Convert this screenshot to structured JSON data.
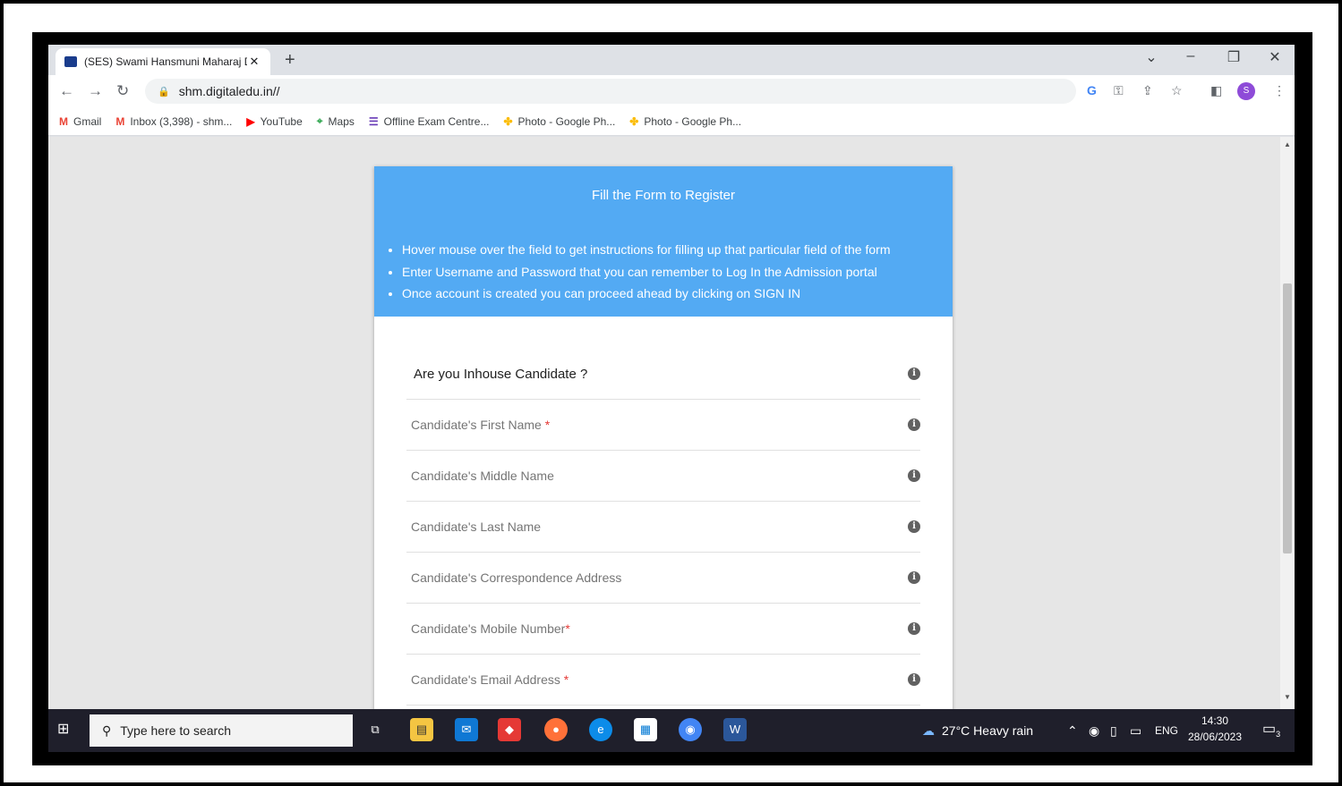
{
  "browser": {
    "tab_title": "(SES) Swami Hansmuni Maharaj D",
    "tab_close": "✕",
    "new_tab": "+",
    "url": "shm.digitaledu.in//",
    "profile_initial": "S",
    "bookmarks": [
      {
        "label": "Gmail",
        "icon": "gmail-icon",
        "color": "#ea4335"
      },
      {
        "label": "Inbox (3,398) - shm...",
        "icon": "gmail-icon",
        "color": "#ea4335"
      },
      {
        "label": "YouTube",
        "icon": "youtube-icon",
        "color": "#ff0000"
      },
      {
        "label": "Maps",
        "icon": "maps-icon",
        "color": "#34a853"
      },
      {
        "label": "Offline Exam Centre...",
        "icon": "forms-icon",
        "color": "#673ab7"
      },
      {
        "label": "Photo - Google Ph...",
        "icon": "photos-icon",
        "color": "#fbbc04"
      },
      {
        "label": "Photo - Google Ph...",
        "icon": "photos-icon",
        "color": "#fbbc04"
      }
    ]
  },
  "form": {
    "title": "Fill the Form to Register",
    "instructions": [
      "Hover mouse over the field to get instructions for filling up that particular field of the form",
      "Enter Username and Password that you can remember to Log In the Admission portal",
      "Once account is created you can proceed ahead by clicking on SIGN IN"
    ],
    "inhouse_label": "Are you Inhouse Candidate ?",
    "fields": {
      "first_name": "Candidate's First Name",
      "middle_name": "Candidate's Middle Name",
      "last_name": "Candidate's Last Name",
      "address": "Candidate's Correspondence Address",
      "mobile": "Candidate's Mobile Number",
      "email": "Candidate's Email Address"
    },
    "required_mark": "*",
    "header_color": "#53aaf3"
  },
  "taskbar": {
    "search_placeholder": "Type here to search",
    "weather": "27°C  Heavy rain",
    "language": "ENG",
    "time": "14:30",
    "date": "28/06/2023",
    "notification_count": "3"
  }
}
